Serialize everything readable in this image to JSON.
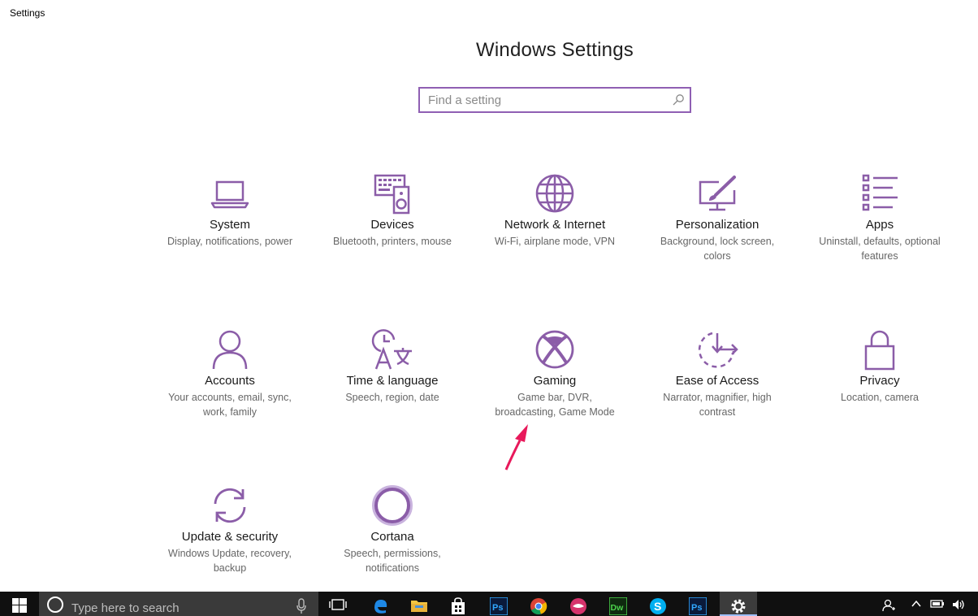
{
  "window": {
    "title": "Settings"
  },
  "header": {
    "title": "Windows Settings"
  },
  "search": {
    "placeholder": "Find a setting"
  },
  "categories": [
    {
      "name": "System",
      "desc": "Display, notifications, power",
      "icon": "laptop-icon"
    },
    {
      "name": "Devices",
      "desc": "Bluetooth, printers, mouse",
      "icon": "keyboard-speaker-icon"
    },
    {
      "name": "Network & Internet",
      "desc": "Wi-Fi, airplane mode, VPN",
      "icon": "globe-icon"
    },
    {
      "name": "Personalization",
      "desc": "Background, lock screen, colors",
      "icon": "paintbrush-display-icon"
    },
    {
      "name": "Apps",
      "desc": "Uninstall, defaults, optional features",
      "icon": "app-list-icon"
    },
    {
      "name": "Accounts",
      "desc": "Your accounts, email, sync, work, family",
      "icon": "person-icon"
    },
    {
      "name": "Time & language",
      "desc": "Speech, region, date",
      "icon": "clock-language-icon"
    },
    {
      "name": "Gaming",
      "desc": "Game bar, DVR, broadcasting, Game Mode",
      "icon": "xbox-icon"
    },
    {
      "name": "Ease of Access",
      "desc": "Narrator, magnifier, high contrast",
      "icon": "ease-of-access-icon"
    },
    {
      "name": "Privacy",
      "desc": "Location, camera",
      "icon": "lock-icon"
    },
    {
      "name": "Update & security",
      "desc": "Windows Update, recovery, backup",
      "icon": "sync-arrows-icon"
    },
    {
      "name": "Cortana",
      "desc": "Speech, permissions, notifications",
      "icon": "cortana-ring-icon"
    }
  ],
  "taskbar": {
    "search_text": "Type here to search",
    "apps": [
      "task-view",
      "edge",
      "file-explorer",
      "store",
      "photoshop",
      "chrome",
      "app-pink",
      "dreamweaver",
      "skype",
      "photoshop",
      "settings"
    ],
    "tray": [
      "people",
      "chevron-up",
      "battery",
      "volume"
    ]
  },
  "colors": {
    "accent": "#8b5da8",
    "arrow": "#e8195b",
    "taskbar": "#101010"
  }
}
